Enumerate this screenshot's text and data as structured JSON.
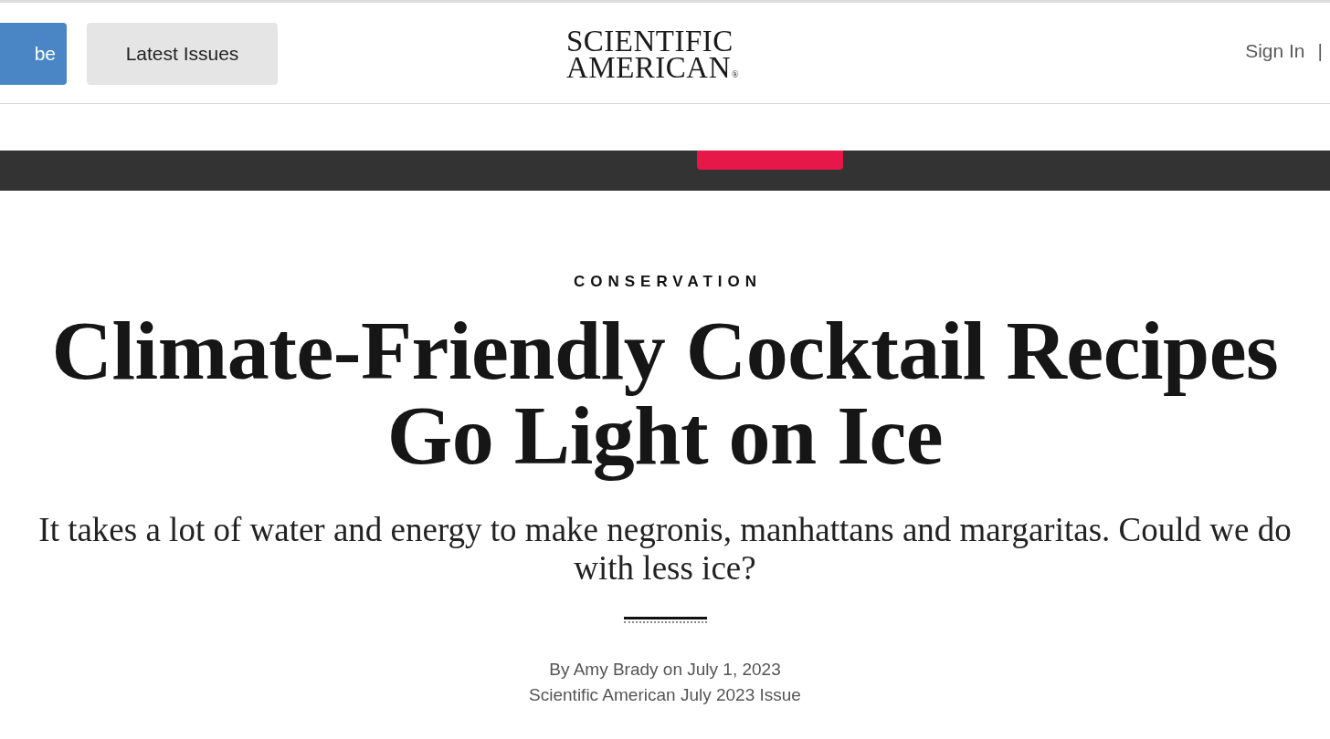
{
  "header": {
    "buttons": [
      {
        "label": "be",
        "kind": "primary"
      },
      {
        "label": "Latest Issues",
        "kind": "secondary"
      }
    ],
    "logo": {
      "lines": [
        "SCIENTIFIC",
        "AMERICAN"
      ],
      "mark": "®"
    },
    "account": {
      "sign_in": "Sign In",
      "separator": "|"
    }
  },
  "article": {
    "category": "CONSERVATION",
    "headline": "Climate-Friendly Cocktail Recipes Go Light on Ice",
    "dek": "It takes a lot of water and energy to make negronis, manhattans and margaritas. Could we do with less ice?",
    "byline": "By Amy Brady on July 1, 2023",
    "issue": "Scientific American July 2023 Issue"
  }
}
